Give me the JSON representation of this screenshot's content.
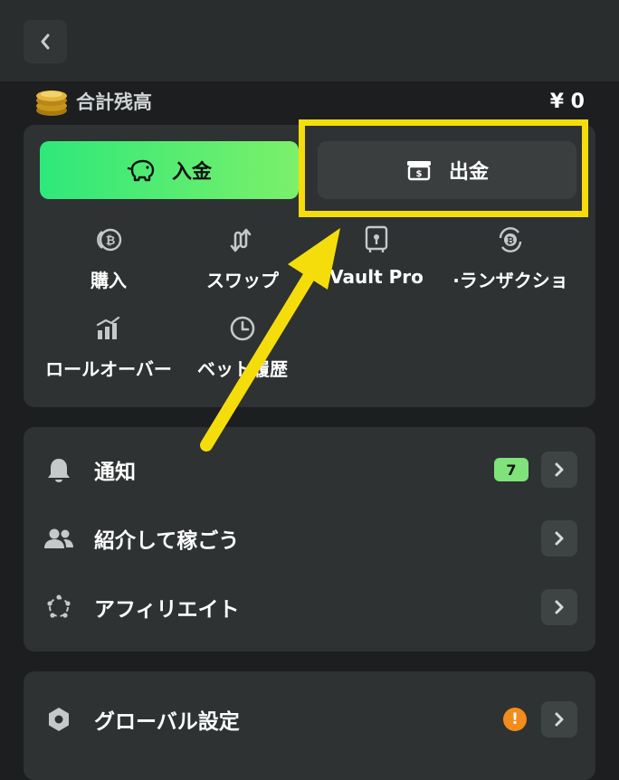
{
  "balance": {
    "label": "合計残高",
    "value": "¥ 0"
  },
  "actions": {
    "deposit_label": "入金",
    "withdraw_label": "出金"
  },
  "quick_links": [
    {
      "label": "購入",
      "icon": "bitcoin-coins-icon"
    },
    {
      "label": "スワップ",
      "icon": "swap-arrows-icon"
    },
    {
      "label": "Vault Pro",
      "icon": "vault-icon"
    },
    {
      "label": "·ランザクショ",
      "icon": "transactions-icon"
    },
    {
      "label": "ロールオーバー",
      "icon": "bar-chart-icon"
    },
    {
      "label": "ベット履歴",
      "icon": "clock-icon"
    }
  ],
  "menu": {
    "notifications": {
      "label": "通知",
      "count": "7",
      "icon": "bell-icon"
    },
    "referral": {
      "label": "紹介して稼ごう",
      "icon": "users-icon"
    },
    "affiliate": {
      "label": "アフィリエイト",
      "icon": "affiliate-ring-icon"
    },
    "global_settings": {
      "label": "グローバル設定",
      "warning": "!",
      "icon": "hexagon-settings-icon"
    }
  },
  "colors": {
    "accent_green": "#2ee87a",
    "highlight_yellow": "#f5dd0c",
    "badge_green": "#7fe27a",
    "warning_orange": "#f28c1a"
  }
}
